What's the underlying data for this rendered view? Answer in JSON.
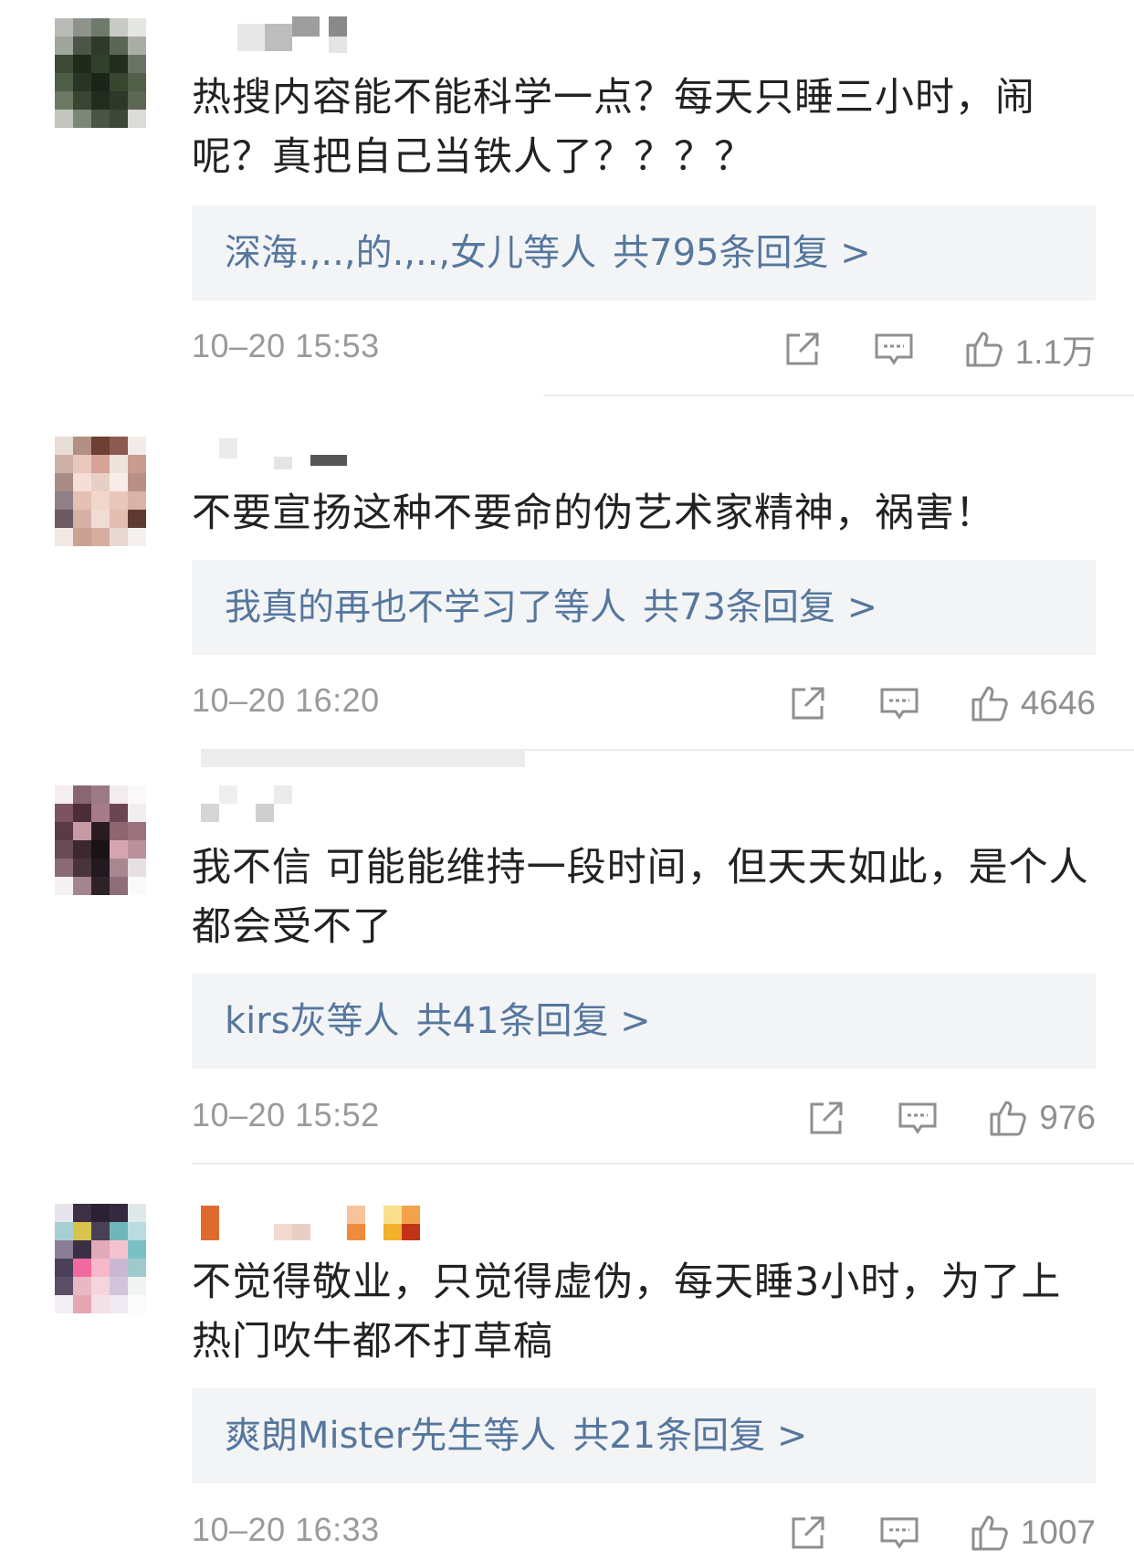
{
  "comments": [
    {
      "text": "热搜内容能不能科学一点？每天只睡三小时，闹呢？真把自己当铁人了？？？？",
      "reply_users": "深海.,..,的.,..,女儿等人",
      "reply_count": "共795条回复 >",
      "time": "10–20 15:53",
      "likes": "1.1万"
    },
    {
      "text": "不要宣扬这种不要命的伪艺术家精神，祸害！",
      "reply_users": "我真的再也不学习了等人",
      "reply_count": "共73条回复 >",
      "time": "10–20 16:20",
      "likes": "4646"
    },
    {
      "text": "我不信 可能能维持一段时间，但天天如此，是个人都会受不了",
      "reply_users": "kirs灰等人",
      "reply_count": "共41条回复 >",
      "time": "10–20 15:52",
      "likes": "976"
    },
    {
      "text": "不觉得敬业，只觉得虚伪，每天睡3小时，为了上热门吹牛都不打草稿",
      "reply_users": "爽朗Mister先生等人",
      "reply_count": "共21条回复 >",
      "time": "10–20 16:33",
      "likes": "1007"
    }
  ],
  "icons": {
    "share": "share-icon",
    "comment": "comment-icon",
    "like": "thumbs-up-icon"
  },
  "colors": {
    "reply_link": "#56779d",
    "reply_bg": "#f3f4f6",
    "meta_text": "#9a9a9a"
  }
}
